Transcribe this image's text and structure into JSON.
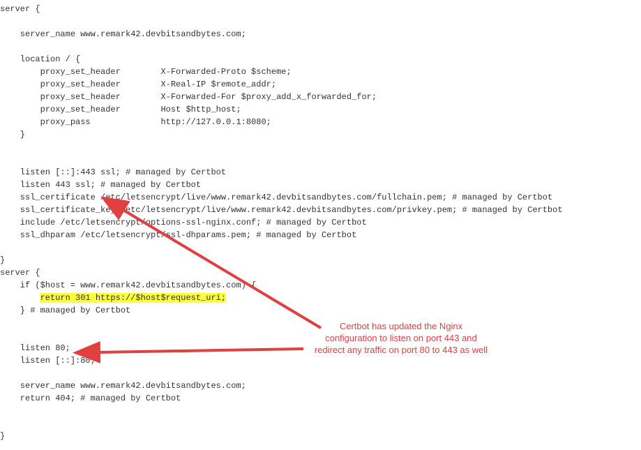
{
  "code": {
    "l01": "server {",
    "l02": "",
    "l03": "    server_name www.remark42.devbitsandbytes.com;",
    "l04": "",
    "l05": "    location / {",
    "l06": "        proxy_set_header        X-Forwarded-Proto $scheme;",
    "l07": "        proxy_set_header        X-Real-IP $remote_addr;",
    "l08": "        proxy_set_header        X-Forwarded-For $proxy_add_x_forwarded_for;",
    "l09": "        proxy_set_header        Host $http_host;",
    "l10": "        proxy_pass              http://127.0.0.1:8080;",
    "l11": "    }",
    "l12": "",
    "l13": "",
    "l14": "    listen [::]:443 ssl; # managed by Certbot",
    "l15": "    listen 443 ssl; # managed by Certbot",
    "l16": "    ssl_certificate /etc/letsencrypt/live/www.remark42.devbitsandbytes.com/fullchain.pem; # managed by Certbot",
    "l17": "    ssl_certificate_key /etc/letsencrypt/live/www.remark42.devbitsandbytes.com/privkey.pem; # managed by Certbot",
    "l18": "    include /etc/letsencrypt/options-ssl-nginx.conf; # managed by Certbot",
    "l19": "    ssl_dhparam /etc/letsencrypt/ssl-dhparams.pem; # managed by Certbot",
    "l20": "",
    "l21": "}",
    "l22": "server {",
    "l23": "    if ($host = www.remark42.devbitsandbytes.com) {",
    "l24_pre": "        ",
    "l24_hl": "return 301 https://$host$request_uri;",
    "l25": "    } # managed by Certbot",
    "l26": "",
    "l27": "",
    "l28": "    listen 80;",
    "l29": "    listen [::]:80;",
    "l30": "",
    "l31": "    server_name www.remark42.devbitsandbytes.com;",
    "l32": "    return 404; # managed by Certbot",
    "l33": "",
    "l34": "",
    "l35": "}"
  },
  "annotation": {
    "line1": "Certbot has updated the Nginx",
    "line2": "configuration to listen on port 443 and",
    "line3": "redirect any traffic on port 80 to 443 as well"
  },
  "colors": {
    "arrow": "#e04040",
    "highlight": "#fcff3a",
    "annotation_text": "#e04040"
  }
}
